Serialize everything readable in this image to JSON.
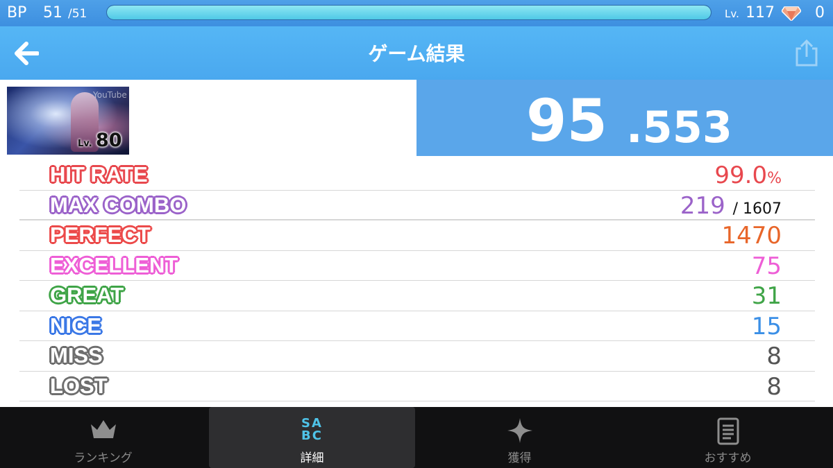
{
  "status_bar": {
    "bp_label": "BP",
    "bp_current": "51",
    "bp_max": "/51",
    "bp_fill_fraction": 1.0,
    "level_prefix": "Lv.",
    "level_value": "117",
    "gem_count": "0"
  },
  "header": {
    "title": "ゲーム結果",
    "back_icon": "arrow-left-icon",
    "share_icon": "share-icon"
  },
  "song": {
    "jacket_watermark": "YouTube",
    "level_prefix": "Lv.",
    "level": "80"
  },
  "score": {
    "integer": "95",
    "decimal": ".553"
  },
  "stats": [
    {
      "label": "HIT RATE",
      "value": "99.0",
      "unit": "%",
      "label_color": "#e8484e",
      "value_color": "#e8484e"
    },
    {
      "label": "MAX COMBO",
      "value": "219",
      "total": "/ 1607",
      "label_color": "#9b63c9",
      "value_color": "#9b63c9"
    },
    {
      "label": "PERFECT",
      "value": "1470",
      "label_color": "#ec4a4a",
      "value_color": "#e8662a"
    },
    {
      "label": "EXCELLENT",
      "value": "75",
      "label_color": "#ee5ed6",
      "value_color": "#ee5ed6"
    },
    {
      "label": "GREAT",
      "value": "31",
      "label_color": "#3fa447",
      "value_color": "#3fa447"
    },
    {
      "label": "NICE",
      "value": "15",
      "label_color": "#3b78e6",
      "value_color": "#3b8fe6"
    },
    {
      "label": "MISS",
      "value": "8",
      "label_color": "#6e6e6e",
      "value_color": "#555555"
    },
    {
      "label": "LOST",
      "value": "8",
      "label_color": "#6e6e6e",
      "value_color": "#555555"
    }
  ],
  "bottom_nav": [
    {
      "label": "ランキング",
      "icon": "crown-icon",
      "active": false
    },
    {
      "label": "詳細",
      "icon": "sabc-grade-icon",
      "icon_text_top": "SA",
      "icon_text_bottom": "BC",
      "active": true
    },
    {
      "label": "獲得",
      "icon": "sparkle-icon",
      "active": false
    },
    {
      "label": "おすすめ",
      "icon": "document-icon",
      "active": false
    }
  ]
}
